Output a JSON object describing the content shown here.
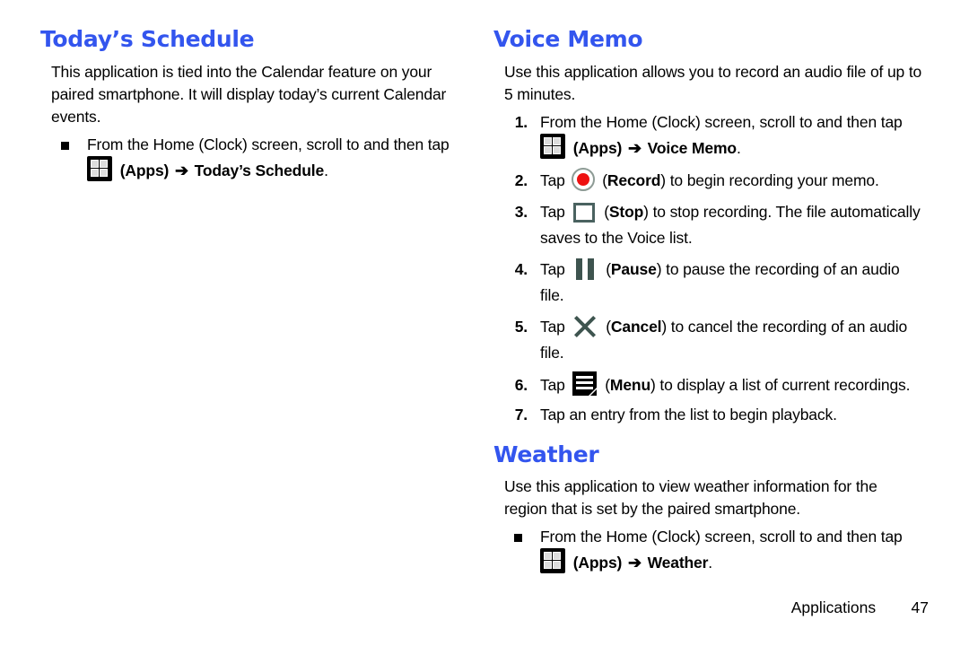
{
  "colors": {
    "heading": "#3355ee",
    "record_dot": "#ee1111",
    "control_icon": "#3e544f",
    "text": "#000000"
  },
  "left_column": {
    "title": "Today’s Schedule",
    "intro": "This application is tied into the Calendar feature on your paired smartphone. It will display today’s current Calendar events.",
    "bullets": [
      {
        "text": "From the Home (Clock) screen, scroll to and then tap",
        "icon": "apps-icon",
        "icon_label": "(Apps)",
        "arrow": "➔",
        "target": "Today’s Schedule",
        "period": "."
      }
    ]
  },
  "right_column": {
    "voice_memo": {
      "title": "Voice Memo",
      "intro": "Use this application allows you to record an audio file of up to 5 minutes.",
      "steps": [
        {
          "num": "1.",
          "text_before": "From the Home (Clock) screen, scroll to and then tap",
          "icon": "apps-icon",
          "icon_label": "(Apps)",
          "arrow": "➔",
          "bold_target": "Voice Memo",
          "text_after": "."
        },
        {
          "num": "2.",
          "text_before": "Tap",
          "icon": "record-icon",
          "paren_open": "(",
          "bold_target": "Record",
          "paren_close": ")",
          "text_after": " to begin recording your memo."
        },
        {
          "num": "3.",
          "text_before": "Tap",
          "icon": "stop-icon",
          "paren_open": "(",
          "bold_target": "Stop",
          "paren_close": ")",
          "text_after": " to stop recording. The file automatically saves to the Voice list."
        },
        {
          "num": "4.",
          "text_before": "Tap",
          "icon": "pause-icon",
          "paren_open": "(",
          "bold_target": "Pause",
          "paren_close": ")",
          "text_after": " to pause the recording of an audio file."
        },
        {
          "num": "5.",
          "text_before": "Tap",
          "icon": "cancel-icon",
          "paren_open": "(",
          "bold_target": "Cancel",
          "paren_close": ")",
          "text_after": " to cancel the recording of an audio file."
        },
        {
          "num": "6.",
          "text_before": "Tap",
          "icon": "menu-icon",
          "paren_open": "(",
          "bold_target": "Menu",
          "paren_close": ")",
          "text_after": " to display a list of current recordings."
        },
        {
          "num": "7.",
          "text_before": "Tap an entry from the list to begin playback.",
          "icon": "",
          "bold_target": "",
          "text_after": ""
        }
      ]
    },
    "weather": {
      "title": "Weather",
      "intro": "Use this application to view weather information for the region that is set by the paired smartphone.",
      "bullets": [
        {
          "text": "From the Home (Clock) screen, scroll to and then tap",
          "icon": "apps-icon",
          "icon_label": "(Apps)",
          "arrow": "➔",
          "target": "Weather",
          "period": "."
        }
      ]
    }
  },
  "footer": {
    "label": "Applications",
    "page_number": "47"
  }
}
